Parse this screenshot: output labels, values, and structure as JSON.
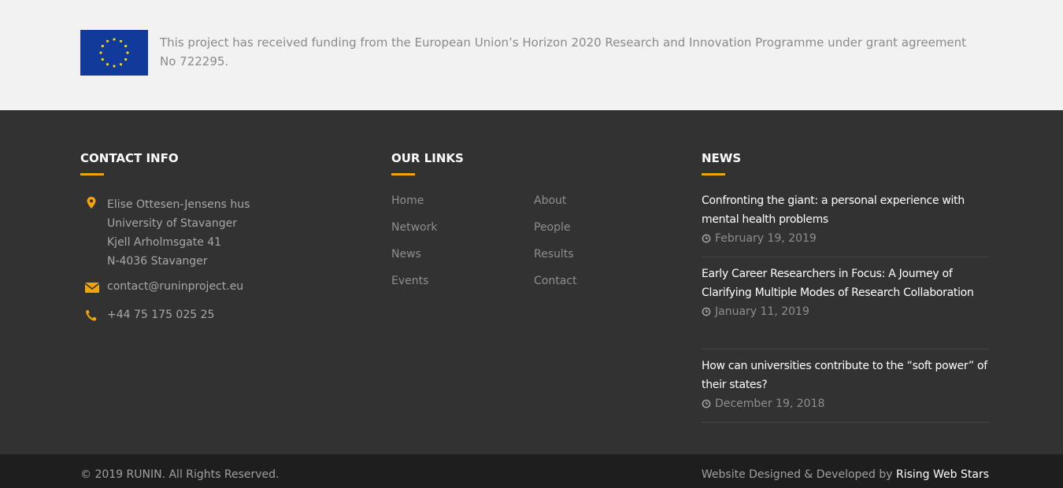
{
  "funding": {
    "flag_icon": "eu-flag",
    "text": "This project has received funding from the European Union’s Horizon 2020 Research and Innovation Programme under grant agreement No 722295."
  },
  "contact": {
    "title": "CONTACT INFO",
    "address_icon": "map-marker-icon",
    "address_lines": [
      "Elise Ottesen-Jensens hus",
      "University of Stavanger",
      "Kjell Arholmsgate 41",
      "N-4036 Stavanger"
    ],
    "email_icon": "envelope-icon",
    "email": "contact@runinproject.eu",
    "phone_icon": "phone-icon",
    "phone": "+44 75 175 025 25"
  },
  "links": {
    "title": "OUR LINKS",
    "col1": [
      "Home",
      "Network",
      "News",
      "Events"
    ],
    "col2": [
      "About",
      "People",
      "Results",
      "Contact"
    ]
  },
  "news": {
    "title": "NEWS",
    "items": [
      {
        "title": "Confronting the giant: a personal experience with mental health problems",
        "date": "February 19, 2019"
      },
      {
        "title": "Early Career Researchers in Focus: A Journey of Clarifying Multiple Modes of Research Collaboration",
        "date": "January 11, 2019"
      },
      {
        "title": "How can universities contribute to the “soft power” of their states?",
        "date": "December 19, 2018"
      }
    ]
  },
  "bottom": {
    "copyright": "© 2019 RUNIN. All Rights Reserved.",
    "credit_prefix": "Website Designed & Developed by",
    "credit_brand": "Rising Web Stars"
  },
  "colors": {
    "accent": "#f0a30a",
    "footer_bg": "#323232",
    "bottom_bg": "#1e1e1e",
    "funding_bg": "#f2f2f2"
  }
}
